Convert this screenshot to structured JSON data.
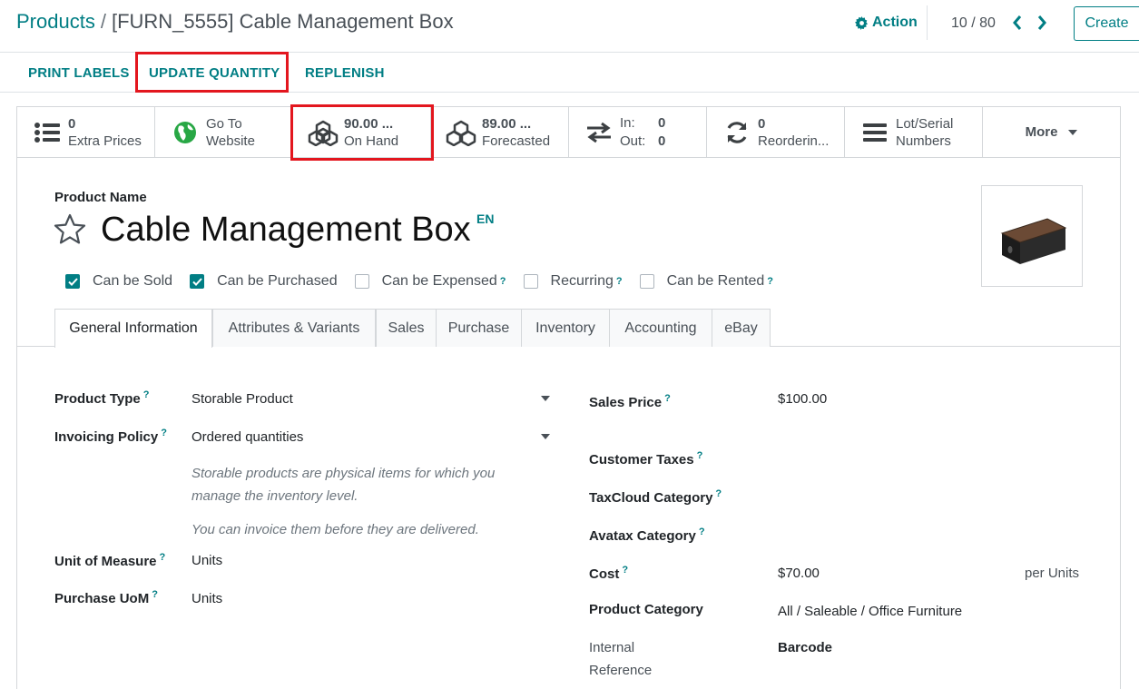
{
  "breadcrumb": {
    "parent": "Products",
    "separator": "/",
    "current": "[FURN_5555] Cable Management Box"
  },
  "header": {
    "action_label": "Action",
    "pager_text": "10 / 80",
    "create_label": "Create"
  },
  "control_buttons": {
    "print_labels": "PRINT LABELS",
    "update_quantity": "UPDATE QUANTITY",
    "replenish": "REPLENISH"
  },
  "smart_buttons": {
    "extra_prices": {
      "value": "0",
      "label": "Extra Prices"
    },
    "website": {
      "line1": "Go To",
      "line2": "Website"
    },
    "on_hand": {
      "value": "90.00 ...",
      "label": "On Hand"
    },
    "forecasted": {
      "value": "89.00 ...",
      "label": "Forecasted"
    },
    "in_out": {
      "in_label": "In:",
      "in_value": "0",
      "out_label": "Out:",
      "out_value": "0"
    },
    "reordering": {
      "value": "0",
      "label": "Reorderin..."
    },
    "lots": {
      "line1": "Lot/Serial",
      "line2": "Numbers"
    },
    "more_label": "More"
  },
  "product": {
    "name_label": "Product Name",
    "name": "Cable Management Box",
    "lang": "EN"
  },
  "checkboxes": [
    {
      "label": "Can be Sold",
      "checked": true,
      "help": false
    },
    {
      "label": "Can be Purchased",
      "checked": true,
      "help": false
    },
    {
      "label": "Can be Expensed",
      "checked": false,
      "help": true
    },
    {
      "label": "Recurring",
      "checked": false,
      "help": true
    },
    {
      "label": "Can be Rented",
      "checked": false,
      "help": true
    }
  ],
  "help_mark": "?",
  "tabs": [
    "General Information",
    "Attributes & Variants",
    "Sales",
    "Purchase",
    "Inventory",
    "Accounting",
    "eBay"
  ],
  "fields_left": {
    "product_type": {
      "label": "Product Type",
      "value": "Storable Product"
    },
    "invoicing_policy": {
      "label": "Invoicing Policy",
      "value": "Ordered quantities"
    },
    "help_line1": "Storable products are physical items for which you",
    "help_line2": "manage the inventory level.",
    "help_line3": "You can invoice them before they are delivered.",
    "uom": {
      "label": "Unit of Measure",
      "value": "Units"
    },
    "purchase_uom": {
      "label": "Purchase UoM",
      "value": "Units"
    }
  },
  "fields_right": {
    "sales_price": {
      "label": "Sales Price",
      "value": "$100.00"
    },
    "customer_taxes": {
      "label": "Customer Taxes"
    },
    "taxcloud": {
      "label": "TaxCloud Category"
    },
    "avatax": {
      "label": "Avatax Category"
    },
    "cost": {
      "label": "Cost",
      "value": "$70.00",
      "unit": "per Units"
    },
    "category": {
      "label": "Product Category",
      "value": "All / Saleable / Office Furniture"
    },
    "internal_ref": {
      "line1": "Internal",
      "line2": "Reference"
    },
    "barcode": {
      "label": "Barcode"
    }
  },
  "colors": {
    "accent": "#017e84",
    "highlight": "#e3161e",
    "text": "#212529"
  },
  "icons": [
    "gear-icon",
    "chevron-left-icon",
    "chevron-right-icon",
    "list-icon",
    "globe-icon",
    "cubes-icon",
    "exchange-icon",
    "refresh-icon",
    "bars-icon",
    "caret-down-icon",
    "star-outline-icon",
    "check-icon"
  ]
}
